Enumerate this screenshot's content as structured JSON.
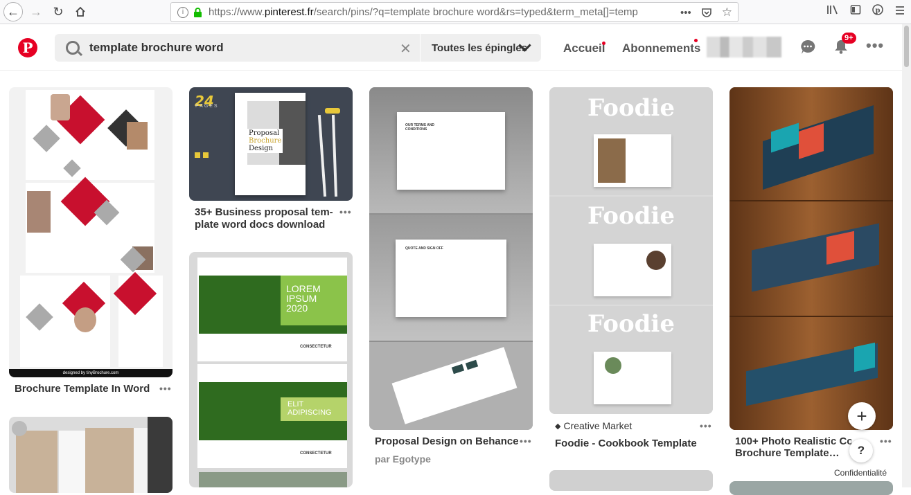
{
  "browser": {
    "url_prefix": "https://www.",
    "url_domain": "pinterest.fr",
    "url_rest": "/search/pins/?q=template brochure word&rs=typed&term_meta[]=temp",
    "more_label": "•••"
  },
  "header": {
    "logo": "P",
    "search_value": "template brochure word",
    "filter_label": "Toutes les épingles",
    "nav_home": "Accueil",
    "nav_following": "Abonnements",
    "notification_badge": "9+"
  },
  "pins": [
    {
      "title": "Brochure Template In Word",
      "image_caption": "designed by tinyBrochure.com"
    },
    {
      "title_line1": "35+ Business proposal tem-",
      "title_line2": "plate word docs download",
      "image_number": "24",
      "image_pages": "PAGES",
      "image_heading_1": "Proposal",
      "image_heading_2": "Brochure",
      "image_heading_3": "Design"
    },
    {
      "title": "Proposal Design on Behance",
      "subtitle": "par Egotype",
      "image_heading_1": "OUR TERMS AND CONDITIONS",
      "image_heading_2": "QUOTE AND SIGN OFF"
    },
    {
      "source": "Creative Market",
      "title": "Foodie - Cookbook Template",
      "image_heading": "Foodie"
    },
    {
      "title_line1": "100+ Photo Realistic Corpo",
      "title_line2": "Brochure Template…"
    },
    {
      "image_heading_1": "LOREM IPSUM 2020",
      "image_heading_2": "ELIT ADIPISCING",
      "image_brand": "CONSECTETUR"
    }
  ],
  "fab_label": "+",
  "help_label": "?",
  "privacy_label": "Confidentialité",
  "colors": {
    "brand": "#e60023",
    "search_bg": "#efefef"
  }
}
